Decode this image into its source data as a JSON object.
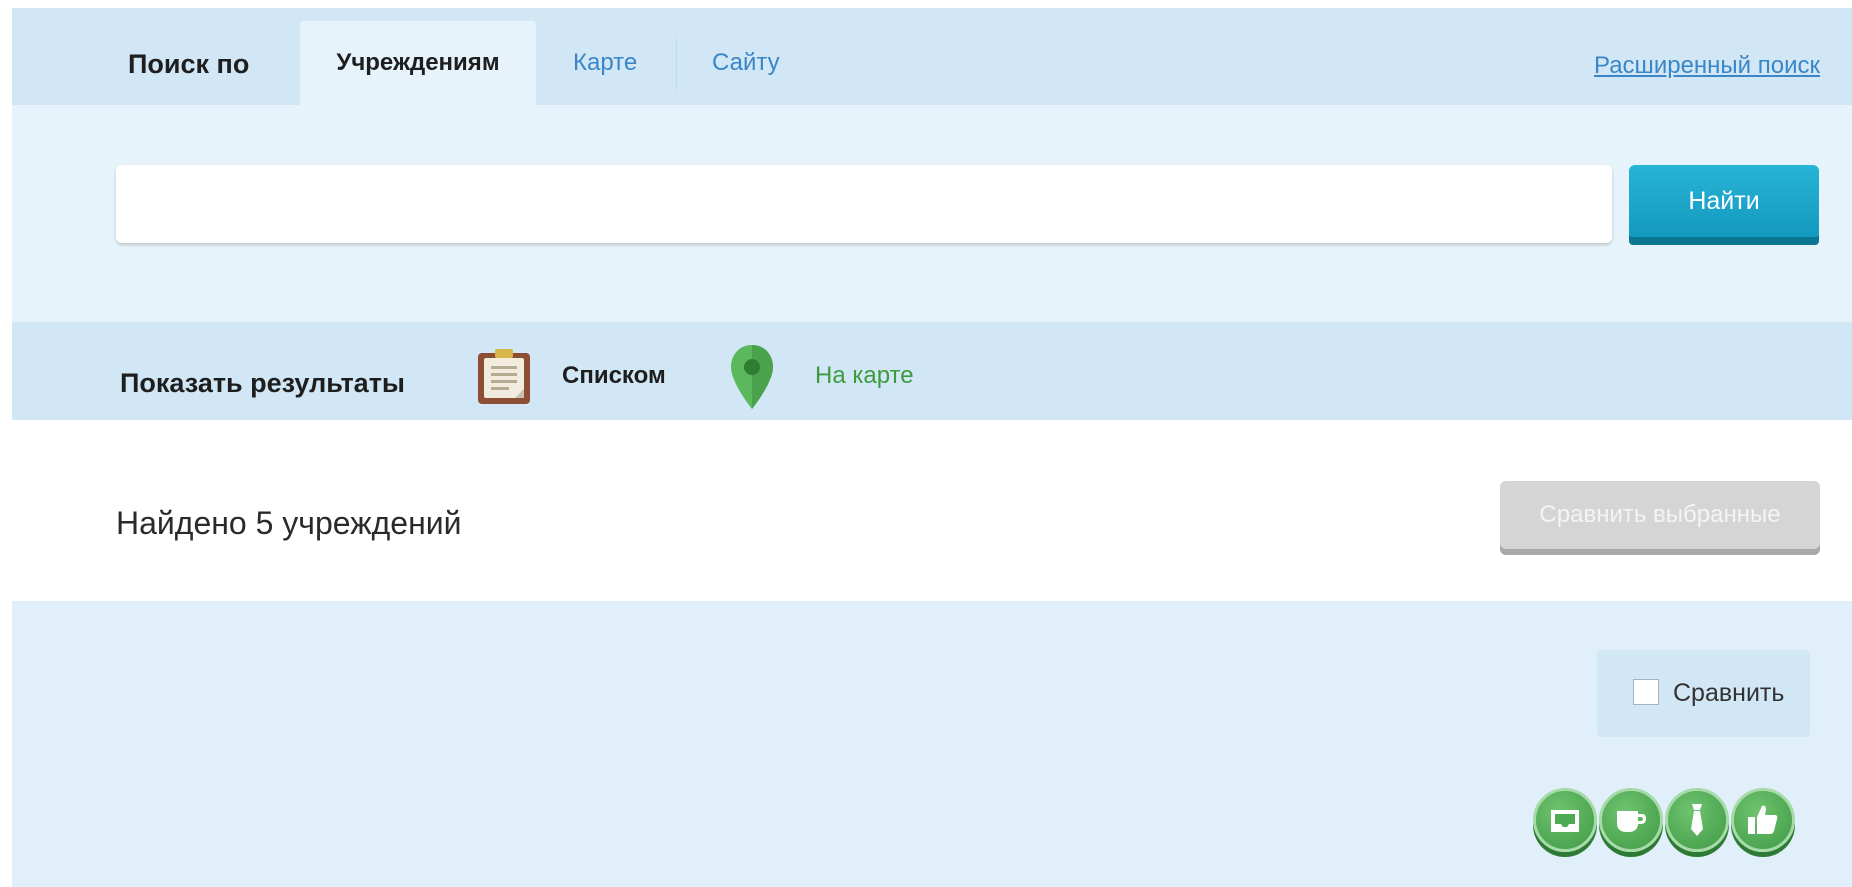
{
  "search_tabs": {
    "label": "Поиск по",
    "tabs": [
      {
        "label": "Учреждениям",
        "active": true
      },
      {
        "label": "Карте",
        "active": false
      },
      {
        "label": "Сайту",
        "active": false
      }
    ],
    "advanced_link": "Расширенный поиск"
  },
  "search": {
    "value": "",
    "placeholder": "",
    "button_label": "Найти"
  },
  "view_mode": {
    "label": "Показать результаты",
    "options": [
      {
        "label": "Списком",
        "icon": "clipboard-icon",
        "active": true
      },
      {
        "label": "На карте",
        "icon": "map-pin-icon",
        "active": false
      }
    ]
  },
  "results": {
    "found_text": "Найдено 5 учреждений",
    "compare_selected_label": "Сравнить выбранные",
    "compare_selected_enabled": false,
    "items": [
      {
        "compare_label": "Сравнить",
        "compare_checked": false,
        "feature_icons": [
          "tray-icon",
          "cup-icon",
          "tie-icon",
          "thumbs-up-icon"
        ]
      }
    ]
  },
  "colors": {
    "accent": "#3a86c8",
    "find_button": "#1ca6cb",
    "map_option": "#3e9a3e",
    "feature_icon_bg": "#4caa52",
    "panel_light": "#e7f3fb",
    "panel_mid": "#d1e7f5"
  }
}
